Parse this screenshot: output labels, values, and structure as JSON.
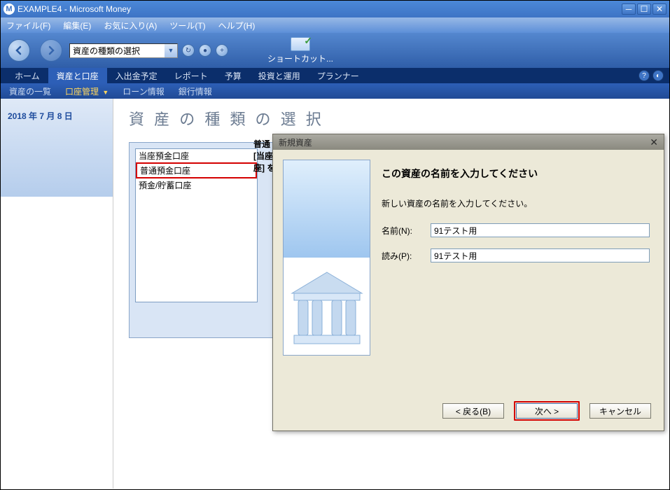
{
  "window": {
    "title": "EXAMPLE4 - Microsoft Money",
    "app_icon_letter": "M"
  },
  "menubar": {
    "file": "ファイル(F)",
    "edit": "編集(E)",
    "favorites": "お気に入り(A)",
    "tools": "ツール(T)",
    "help": "ヘルプ(H)"
  },
  "toolbar": {
    "combo_value": "資産の種類の選択",
    "shortcut_label": "ショートカット..."
  },
  "nav": {
    "home": "ホーム",
    "accounts": "資産と口座",
    "budget": "入出金予定",
    "report": "レポート",
    "yotei": "予算",
    "invest": "投資と運用",
    "planner": "プランナー"
  },
  "subnav": {
    "list": "資産の一覧",
    "mgmt": "口座管理",
    "loan": "ローン情報",
    "bank": "銀行情報"
  },
  "sidebar": {
    "date": "2018 年 7 月 8 日"
  },
  "page": {
    "title": "資 産 の 種 類 の 選 択",
    "list_label": "普通\n[当座\n座] を"
  },
  "listbox": {
    "items": [
      "当座預金口座",
      "普通預金口座",
      "預金/貯蓄口座"
    ],
    "selected_index": 1
  },
  "dialog": {
    "title": "新規資産",
    "heading": "この資産の名前を入力してください",
    "hint": "新しい資産の名前を入力してください。",
    "name_label": "名前(N):",
    "name_value": "91テスト用",
    "yomi_label": "読み(P):",
    "yomi_value": "91テスト用",
    "back": "< 戻る(B)",
    "next": "次へ >",
    "cancel": "キャンセル"
  }
}
